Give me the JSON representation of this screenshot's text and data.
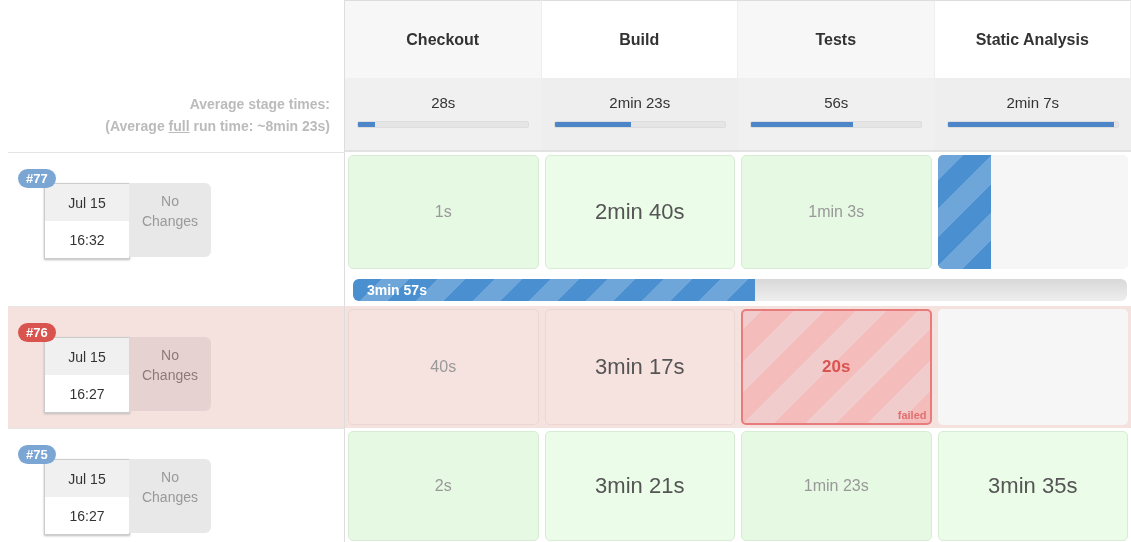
{
  "stages": [
    {
      "name": "Checkout",
      "average": "28s",
      "level": 0.1
    },
    {
      "name": "Build",
      "average": "2min 23s",
      "level": 0.45
    },
    {
      "name": "Tests",
      "average": "56s",
      "level": 0.6
    },
    {
      "name": "Static Analysis",
      "average": "2min 7s",
      "level": 0.98
    }
  ],
  "averages": {
    "label": "Average stage times:",
    "full_prefix": "(Average ",
    "full_link": "full",
    "full_suffix": " run time: ~8min 23s)"
  },
  "runs": [
    {
      "number": "#77",
      "color": "#7ba6d4",
      "failed": false,
      "date": "Jul 15",
      "time": "16:32",
      "changes": "No Changes",
      "cells": [
        {
          "kind": "success",
          "text": "1s",
          "slow": false
        },
        {
          "kind": "success",
          "text": "2min 40s",
          "slow": true
        },
        {
          "kind": "success",
          "text": "1min 3s",
          "slow": false
        },
        {
          "kind": "running",
          "level": 0.28
        }
      ],
      "progress": {
        "text": "3min 57s",
        "level": 0.52
      }
    },
    {
      "number": "#76",
      "color": "#d9534f",
      "failed": true,
      "date": "Jul 15",
      "time": "16:27",
      "changes": "No Changes",
      "cells": [
        {
          "kind": "success",
          "text": "40s",
          "slow": false
        },
        {
          "kind": "success",
          "text": "3min 17s",
          "slow": true
        },
        {
          "kind": "failed",
          "text": "20s",
          "note": "failed"
        },
        {
          "kind": "empty"
        }
      ]
    },
    {
      "number": "#75",
      "color": "#7ba6d4",
      "failed": false,
      "date": "Jul 15",
      "time": "16:27",
      "changes": "No Changes",
      "cells": [
        {
          "kind": "success",
          "text": "2s",
          "slow": false
        },
        {
          "kind": "success",
          "text": "3min 21s",
          "slow": true
        },
        {
          "kind": "success",
          "text": "1min 23s",
          "slow": false
        },
        {
          "kind": "success",
          "text": "3min 35s",
          "slow": true
        }
      ]
    }
  ]
}
